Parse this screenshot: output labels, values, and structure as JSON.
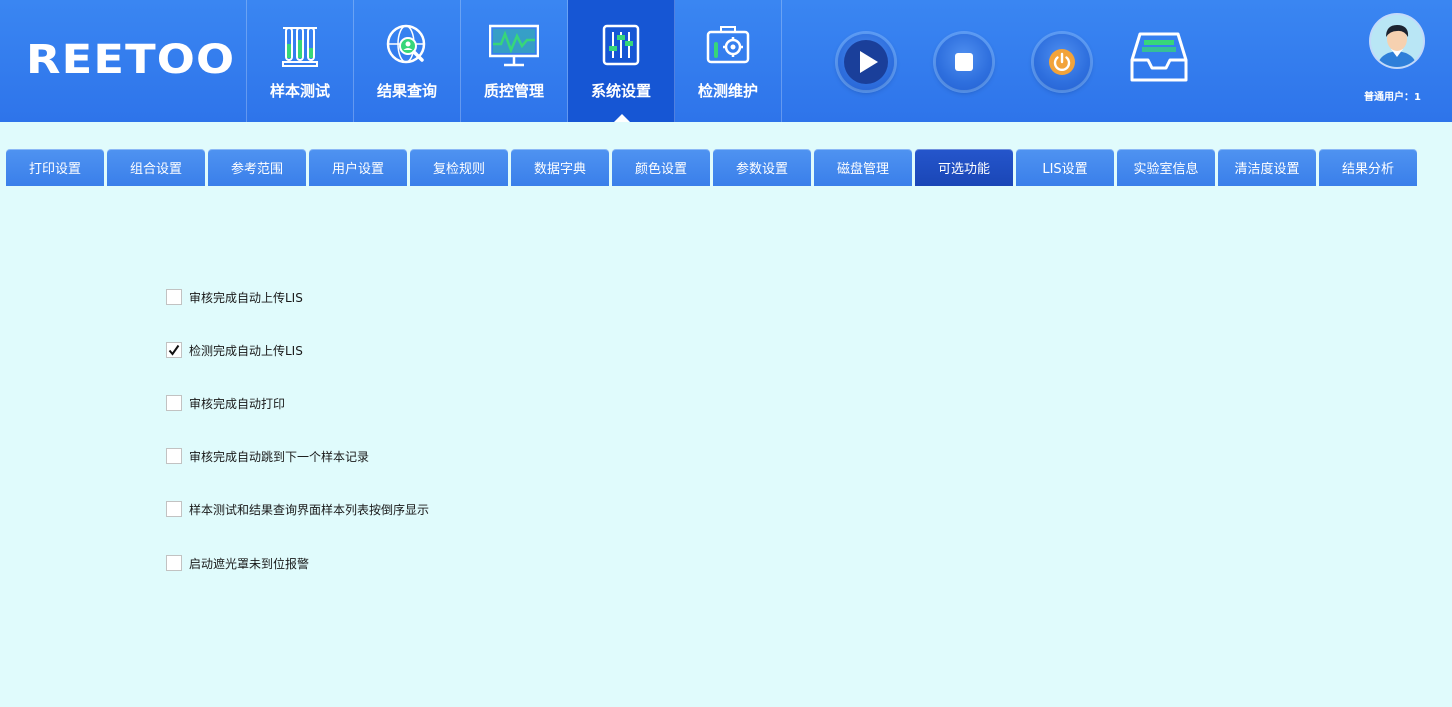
{
  "app": {
    "logo": "REETOO"
  },
  "nav": [
    {
      "label": "样本测试",
      "icon": "test-tubes-icon"
    },
    {
      "label": "结果查询",
      "icon": "globe-search-icon"
    },
    {
      "label": "质控管理",
      "icon": "monitor-chart-icon"
    },
    {
      "label": "系统设置",
      "icon": "sliders-icon",
      "active": true
    },
    {
      "label": "检测维护",
      "icon": "toolbox-gear-icon"
    }
  ],
  "controls": [
    {
      "name": "play-icon"
    },
    {
      "name": "stop-icon"
    },
    {
      "name": "power-icon"
    },
    {
      "name": "tray-icon"
    }
  ],
  "user": {
    "label": "普通用户：1",
    "icon": "user-avatar-icon"
  },
  "tabs": [
    {
      "label": "打印设置"
    },
    {
      "label": "组合设置"
    },
    {
      "label": "参考范围"
    },
    {
      "label": "用户设置"
    },
    {
      "label": "复检规则"
    },
    {
      "label": "数据字典"
    },
    {
      "label": "颜色设置"
    },
    {
      "label": "参数设置"
    },
    {
      "label": "磁盘管理"
    },
    {
      "label": "可选功能",
      "active": true
    },
    {
      "label": "LIS设置"
    },
    {
      "label": "实验室信息"
    },
    {
      "label": "清洁度设置"
    },
    {
      "label": "结果分析"
    }
  ],
  "options": [
    {
      "label": "审核完成自动上传LIS",
      "checked": false
    },
    {
      "label": "检测完成自动上传LIS",
      "checked": true
    },
    {
      "label": "审核完成自动打印",
      "checked": false
    },
    {
      "label": "审核完成自动跳到下一个样本记录",
      "checked": false
    },
    {
      "label": "样本测试和结果查询界面样本列表按倒序显示",
      "checked": false
    },
    {
      "label": "启动遮光罩未到位报警",
      "checked": false
    }
  ],
  "colors": {
    "header": "#2e74ea",
    "nav_active": "#1656d4",
    "tab": "#3a7fea",
    "tab_active": "#1a46b6",
    "background": "#e0fbfc",
    "power_accent": "#f2a33a"
  }
}
